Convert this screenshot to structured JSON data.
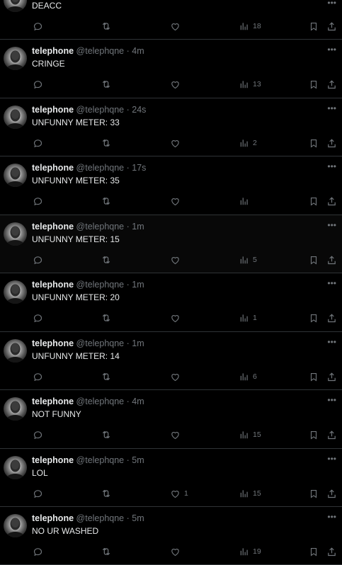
{
  "posts": [
    {
      "name": "",
      "handle": "",
      "time": "",
      "text": "DEACC",
      "replies": "",
      "reposts": "",
      "likes": "",
      "views": "18"
    },
    {
      "name": "telephone",
      "handle": "@telephqne",
      "time": "4m",
      "text": "CRINGE",
      "replies": "",
      "reposts": "",
      "likes": "",
      "views": "13"
    },
    {
      "name": "telephone",
      "handle": "@telephqne",
      "time": "24s",
      "text": "UNFUNNY METER: 33",
      "replies": "",
      "reposts": "",
      "likes": "",
      "views": "2"
    },
    {
      "name": "telephone",
      "handle": "@telephqne",
      "time": "17s",
      "text": "UNFUNNY METER: 35",
      "replies": "",
      "reposts": "",
      "likes": "",
      "views": ""
    },
    {
      "name": "telephone",
      "handle": "@telephqne",
      "time": "1m",
      "text": "UNFUNNY METER: 15",
      "replies": "",
      "reposts": "",
      "likes": "",
      "views": "5"
    },
    {
      "name": "telephone",
      "handle": "@telephqne",
      "time": "1m",
      "text": "UNFUNNY METER: 20",
      "replies": "",
      "reposts": "",
      "likes": "",
      "views": "1"
    },
    {
      "name": "telephone",
      "handle": "@telephqne",
      "time": "1m",
      "text": "UNFUNNY METER: 14",
      "replies": "",
      "reposts": "",
      "likes": "",
      "views": "6"
    },
    {
      "name": "telephone",
      "handle": "@telephqne",
      "time": "4m",
      "text": "NOT FUNNY",
      "replies": "",
      "reposts": "",
      "likes": "",
      "views": "15"
    },
    {
      "name": "telephone",
      "handle": "@telephqne",
      "time": "5m",
      "text": "LOL",
      "replies": "",
      "reposts": "",
      "likes": "1",
      "views": "15"
    },
    {
      "name": "telephone",
      "handle": "@telephqne",
      "time": "5m",
      "text": "NO UR WASHED",
      "replies": "",
      "reposts": "",
      "likes": "",
      "views": "19"
    }
  ],
  "meta_separator": "·",
  "more_glyph": "•••",
  "icons": {
    "reply": "reply-icon",
    "repost": "repost-icon",
    "like": "heart-icon",
    "views": "views-icon",
    "bookmark": "bookmark-icon",
    "share": "share-icon",
    "more": "more-icon"
  },
  "colors": {
    "background": "#000000",
    "text": "#e7e9ea",
    "muted": "#71767b",
    "divider": "#2f3336",
    "highlight": "#080808"
  }
}
